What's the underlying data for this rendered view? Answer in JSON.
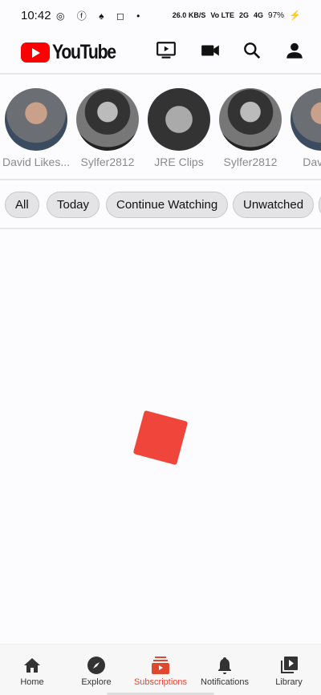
{
  "status": {
    "time": "10:42",
    "apps": "◎ ⓕ ♠ ◻ •",
    "speed": "26.0 KB/S",
    "volte": "Vo LTE",
    "net1": "2G",
    "net2": "4G",
    "battery": "97%"
  },
  "header": {
    "logo": "YouTube"
  },
  "subscriptions": [
    {
      "name": "David Likes..."
    },
    {
      "name": "Sylfer2812"
    },
    {
      "name": "JRE Clips"
    },
    {
      "name": "Sylfer2812"
    },
    {
      "name": "David L"
    }
  ],
  "filters": [
    "All",
    "Today",
    "Continue Watching",
    "Unwatched"
  ],
  "nav": [
    {
      "label": "Home"
    },
    {
      "label": "Explore"
    },
    {
      "label": "Subscriptions"
    },
    {
      "label": "Notifications"
    },
    {
      "label": "Library"
    }
  ],
  "colors": {
    "accent": "#e0472f",
    "logo_red": "#ff0000",
    "spinner": "#f0453a"
  }
}
